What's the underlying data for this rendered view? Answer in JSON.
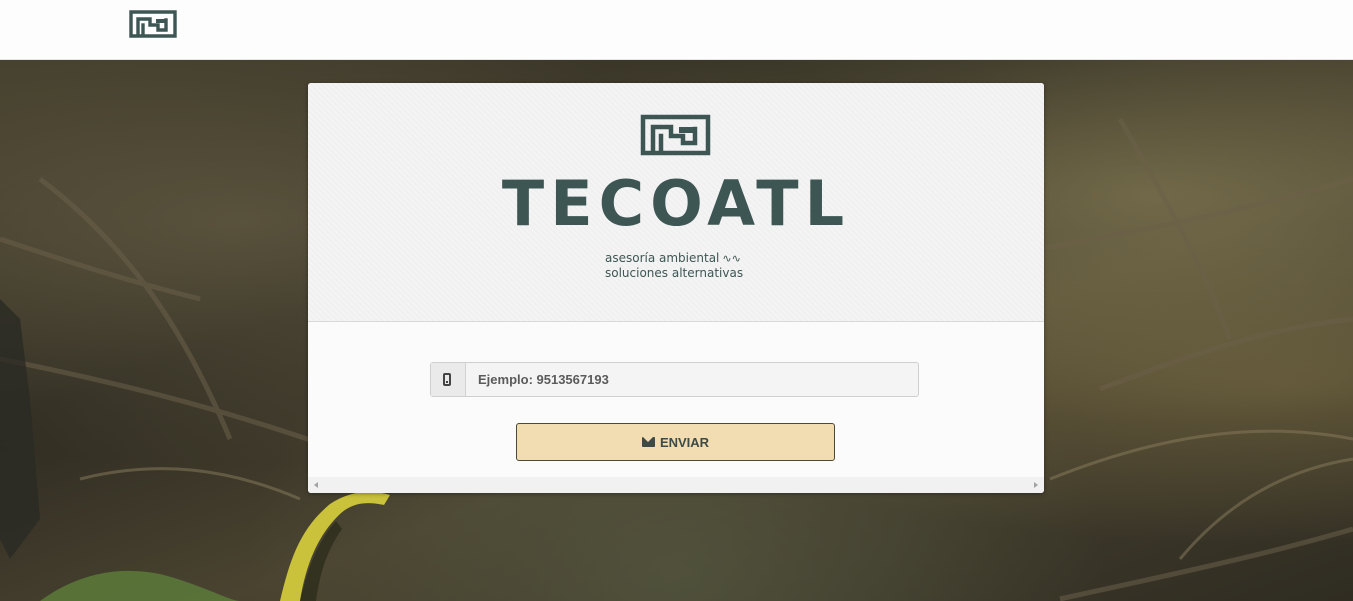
{
  "header": {
    "logo_icon": "tecoatl-glyph-icon"
  },
  "card": {
    "brand_name": "TECOATL",
    "tagline_line1": "asesoría ambiental",
    "tagline_wave": "∿∿",
    "tagline_line2": "soluciones alternativas"
  },
  "form": {
    "phone_icon": "mobile-phone-icon",
    "phone_placeholder": "Ejemplo: 9513567193",
    "phone_value": "",
    "send_icon": "envelope-icon",
    "send_label": "ENVIAR"
  },
  "colors": {
    "brand": "#3d5653",
    "button_bg": "#f2dcb1",
    "topbar_bg": "#fdfdfd"
  }
}
